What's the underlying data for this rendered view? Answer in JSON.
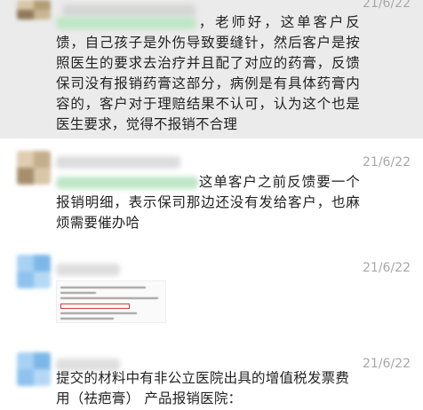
{
  "messages": [
    {
      "time": "21/6/22",
      "text_after_mention": "，老师好，这单客户反馈，自己孩子是外伤导致要缝针，然后客户是按照医生的要求去治疗并且配了对应的药膏，反馈保司没有报销药膏这部分，病例是有具体药膏内容的，客户对于理赔结果不认可，认为这个也是医生要求，觉得不报销不合理"
    },
    {
      "time": "21/6/22",
      "text_after_mention": "这单客户之前反馈要一个报销明细，表示保司那边还没有发给客户，也麻烦需要催办哈"
    },
    {
      "time": "21/6/22"
    },
    {
      "time": "21/6/22",
      "text": "提交的材料中有非公立医院出具的增值税发票费用（祛疤膏） 产品报销医院："
    }
  ],
  "colors": {
    "highlight_bg": "#ebebeb",
    "mention_green": "#bfe6c7",
    "avatar_blue": "#8ec3ee"
  },
  "icons": {
    "avatars": [
      "blurred-avatar-beige",
      "blurred-avatar-beige",
      "blurred-avatar-blue",
      "blurred-avatar-blue"
    ]
  }
}
